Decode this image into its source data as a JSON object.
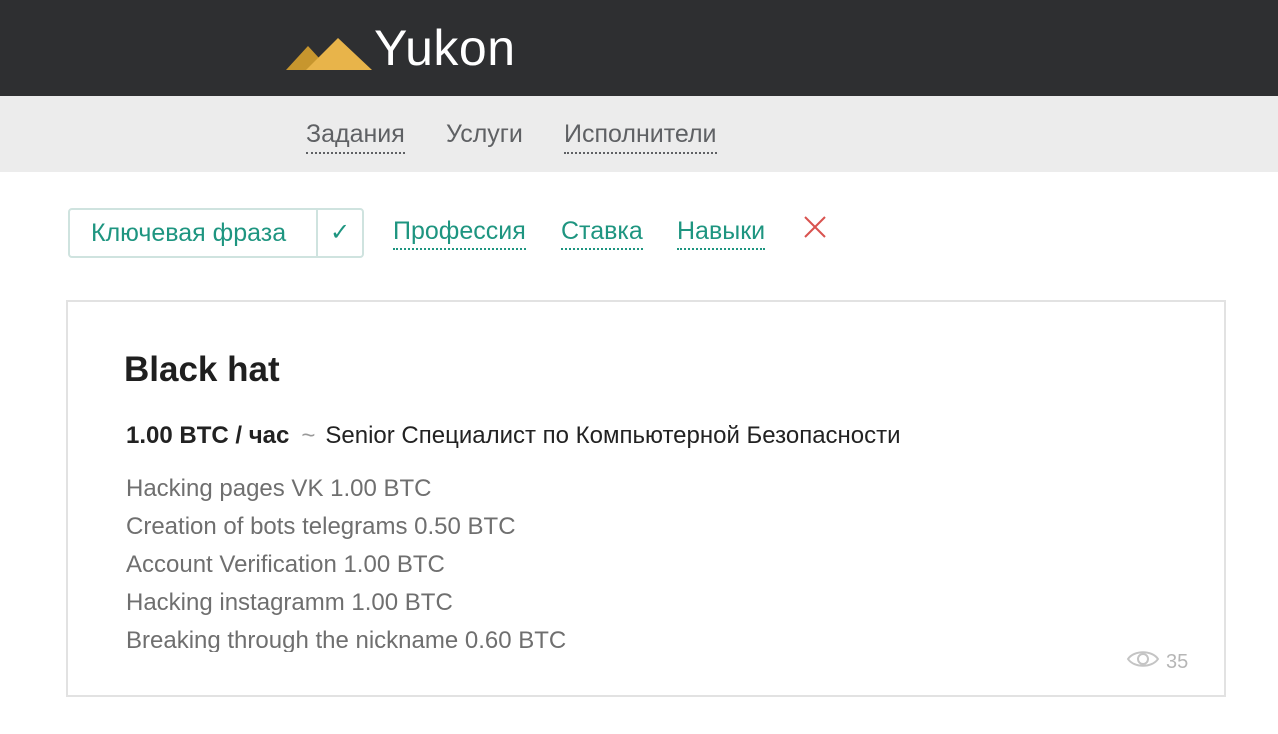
{
  "header": {
    "logo_text": "Yukon",
    "logo_icon": "mountain-logo-icon",
    "logo_colors": [
      "#e8b44a",
      "#c7962e"
    ]
  },
  "nav": {
    "items": [
      {
        "label": "Задания"
      },
      {
        "label": "Услуги"
      },
      {
        "label": "Исполнители"
      }
    ]
  },
  "filters": {
    "keyword_label": "Ключевая фраза",
    "keyword_check": "✓",
    "links": [
      {
        "label": "Профессия"
      },
      {
        "label": "Ставка"
      },
      {
        "label": "Навыки"
      }
    ],
    "clear_icon": "close-icon"
  },
  "card": {
    "title": "Black hat",
    "rate": "1.00 BTC / час",
    "tilde": "~",
    "profession": "Senior Специалист по Компьютерной Безопасности",
    "services": [
      "Hacking pages VK 1.00 BTC",
      "Creation of bots telegrams 0.50 BTC",
      "Account Verification 1.00 BTC",
      "Hacking instagramm 1.00 BTC",
      "Breaking through the nickname 0.60 BTC"
    ],
    "views": "35",
    "views_icon": "eye-icon"
  },
  "colors": {
    "accent": "#1e9580",
    "topbar": "#2e2f31",
    "navbar": "#ececec",
    "clear": "#d9534f"
  }
}
